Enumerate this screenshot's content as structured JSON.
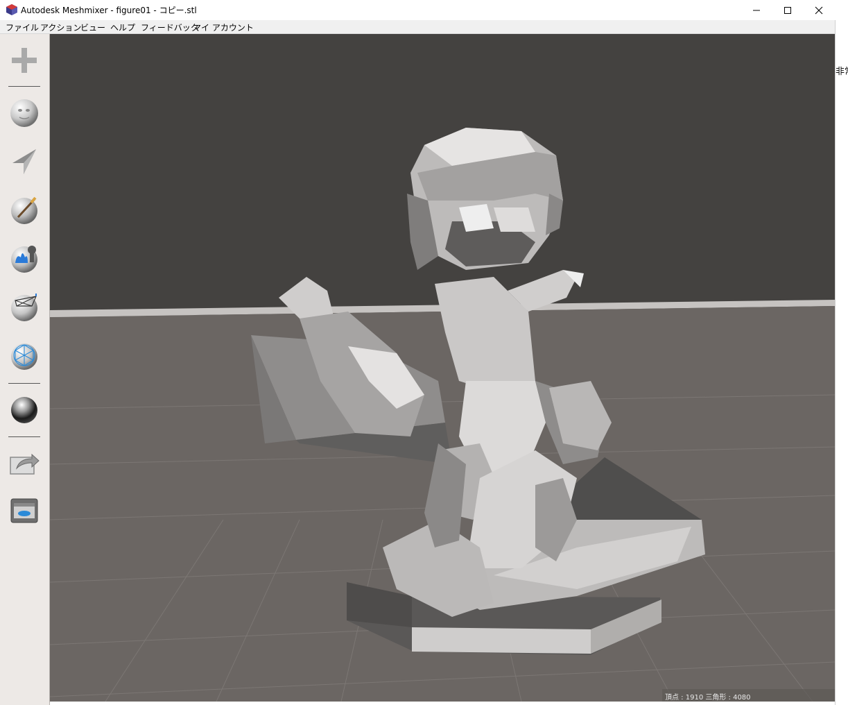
{
  "window": {
    "title": "Autodesk Meshmixer - figure01 - コピー.stl",
    "controls": [
      "minimize-icon",
      "maximize-icon",
      "close-icon"
    ]
  },
  "menu": {
    "items": [
      {
        "label": "ファイル"
      },
      {
        "label": "アクション"
      },
      {
        "label": "ビュー"
      },
      {
        "label": "ヘルプ"
      },
      {
        "label": "フィードバック"
      },
      {
        "label": "マイ アカウント"
      }
    ]
  },
  "toolbar": {
    "tools": [
      {
        "name": "import-plus-icon"
      },
      {
        "name": "meshmix-face-icon"
      },
      {
        "name": "select-arrow-icon"
      },
      {
        "name": "sculpt-brush-icon"
      },
      {
        "name": "stamp-icon"
      },
      {
        "name": "edit-mesh-icon"
      },
      {
        "name": "analysis-icon"
      },
      {
        "name": "shaders-sphere-icon"
      },
      {
        "name": "export-icon"
      },
      {
        "name": "print-icon"
      }
    ]
  },
  "side_panel": {
    "clipped_text": "非常"
  },
  "status": {
    "text": "頂点 : 1910 三角形 : 4080"
  },
  "colors": {
    "viewport_bg": "#444240",
    "floor": "#6b6663",
    "toolbar_bg": "#ede9e6",
    "menubar_bg": "#f0f0f0"
  }
}
